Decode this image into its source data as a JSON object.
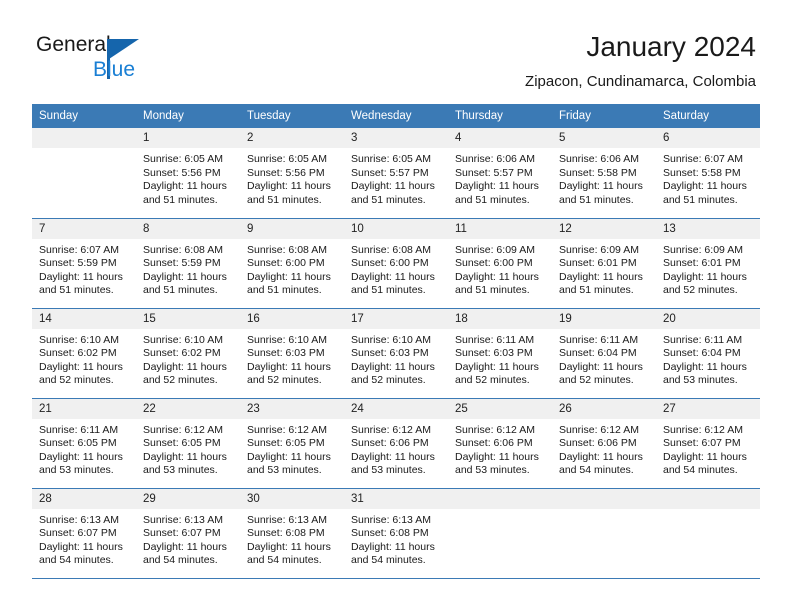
{
  "brand": {
    "line1": "General",
    "line2": "Blue",
    "mark_icon": "triangle-logo-icon"
  },
  "header": {
    "title": "January 2024",
    "subtitle": "Zipacon, Cundinamarca, Colombia"
  },
  "colors": {
    "header_blue": "#3b7ab5",
    "brand_blue": "#1a7fd4",
    "mark_blue": "#1565ac",
    "daynum_bg": "#f0f0f0"
  },
  "weekdays": [
    "Sunday",
    "Monday",
    "Tuesday",
    "Wednesday",
    "Thursday",
    "Friday",
    "Saturday"
  ],
  "labels": {
    "sunrise_prefix": "Sunrise:",
    "sunset_prefix": "Sunset:",
    "daylight_prefix": "Daylight:"
  },
  "weeks": [
    [
      {
        "empty": true
      },
      {
        "day": "1",
        "sunrise": "Sunrise: 6:05 AM",
        "sunset": "Sunset: 5:56 PM",
        "daylight1": "Daylight: 11 hours",
        "daylight2": "and 51 minutes."
      },
      {
        "day": "2",
        "sunrise": "Sunrise: 6:05 AM",
        "sunset": "Sunset: 5:56 PM",
        "daylight1": "Daylight: 11 hours",
        "daylight2": "and 51 minutes."
      },
      {
        "day": "3",
        "sunrise": "Sunrise: 6:05 AM",
        "sunset": "Sunset: 5:57 PM",
        "daylight1": "Daylight: 11 hours",
        "daylight2": "and 51 minutes."
      },
      {
        "day": "4",
        "sunrise": "Sunrise: 6:06 AM",
        "sunset": "Sunset: 5:57 PM",
        "daylight1": "Daylight: 11 hours",
        "daylight2": "and 51 minutes."
      },
      {
        "day": "5",
        "sunrise": "Sunrise: 6:06 AM",
        "sunset": "Sunset: 5:58 PM",
        "daylight1": "Daylight: 11 hours",
        "daylight2": "and 51 minutes."
      },
      {
        "day": "6",
        "sunrise": "Sunrise: 6:07 AM",
        "sunset": "Sunset: 5:58 PM",
        "daylight1": "Daylight: 11 hours",
        "daylight2": "and 51 minutes."
      }
    ],
    [
      {
        "day": "7",
        "sunrise": "Sunrise: 6:07 AM",
        "sunset": "Sunset: 5:59 PM",
        "daylight1": "Daylight: 11 hours",
        "daylight2": "and 51 minutes."
      },
      {
        "day": "8",
        "sunrise": "Sunrise: 6:08 AM",
        "sunset": "Sunset: 5:59 PM",
        "daylight1": "Daylight: 11 hours",
        "daylight2": "and 51 minutes."
      },
      {
        "day": "9",
        "sunrise": "Sunrise: 6:08 AM",
        "sunset": "Sunset: 6:00 PM",
        "daylight1": "Daylight: 11 hours",
        "daylight2": "and 51 minutes."
      },
      {
        "day": "10",
        "sunrise": "Sunrise: 6:08 AM",
        "sunset": "Sunset: 6:00 PM",
        "daylight1": "Daylight: 11 hours",
        "daylight2": "and 51 minutes."
      },
      {
        "day": "11",
        "sunrise": "Sunrise: 6:09 AM",
        "sunset": "Sunset: 6:00 PM",
        "daylight1": "Daylight: 11 hours",
        "daylight2": "and 51 minutes."
      },
      {
        "day": "12",
        "sunrise": "Sunrise: 6:09 AM",
        "sunset": "Sunset: 6:01 PM",
        "daylight1": "Daylight: 11 hours",
        "daylight2": "and 51 minutes."
      },
      {
        "day": "13",
        "sunrise": "Sunrise: 6:09 AM",
        "sunset": "Sunset: 6:01 PM",
        "daylight1": "Daylight: 11 hours",
        "daylight2": "and 52 minutes."
      }
    ],
    [
      {
        "day": "14",
        "sunrise": "Sunrise: 6:10 AM",
        "sunset": "Sunset: 6:02 PM",
        "daylight1": "Daylight: 11 hours",
        "daylight2": "and 52 minutes."
      },
      {
        "day": "15",
        "sunrise": "Sunrise: 6:10 AM",
        "sunset": "Sunset: 6:02 PM",
        "daylight1": "Daylight: 11 hours",
        "daylight2": "and 52 minutes."
      },
      {
        "day": "16",
        "sunrise": "Sunrise: 6:10 AM",
        "sunset": "Sunset: 6:03 PM",
        "daylight1": "Daylight: 11 hours",
        "daylight2": "and 52 minutes."
      },
      {
        "day": "17",
        "sunrise": "Sunrise: 6:10 AM",
        "sunset": "Sunset: 6:03 PM",
        "daylight1": "Daylight: 11 hours",
        "daylight2": "and 52 minutes."
      },
      {
        "day": "18",
        "sunrise": "Sunrise: 6:11 AM",
        "sunset": "Sunset: 6:03 PM",
        "daylight1": "Daylight: 11 hours",
        "daylight2": "and 52 minutes."
      },
      {
        "day": "19",
        "sunrise": "Sunrise: 6:11 AM",
        "sunset": "Sunset: 6:04 PM",
        "daylight1": "Daylight: 11 hours",
        "daylight2": "and 52 minutes."
      },
      {
        "day": "20",
        "sunrise": "Sunrise: 6:11 AM",
        "sunset": "Sunset: 6:04 PM",
        "daylight1": "Daylight: 11 hours",
        "daylight2": "and 53 minutes."
      }
    ],
    [
      {
        "day": "21",
        "sunrise": "Sunrise: 6:11 AM",
        "sunset": "Sunset: 6:05 PM",
        "daylight1": "Daylight: 11 hours",
        "daylight2": "and 53 minutes."
      },
      {
        "day": "22",
        "sunrise": "Sunrise: 6:12 AM",
        "sunset": "Sunset: 6:05 PM",
        "daylight1": "Daylight: 11 hours",
        "daylight2": "and 53 minutes."
      },
      {
        "day": "23",
        "sunrise": "Sunrise: 6:12 AM",
        "sunset": "Sunset: 6:05 PM",
        "daylight1": "Daylight: 11 hours",
        "daylight2": "and 53 minutes."
      },
      {
        "day": "24",
        "sunrise": "Sunrise: 6:12 AM",
        "sunset": "Sunset: 6:06 PM",
        "daylight1": "Daylight: 11 hours",
        "daylight2": "and 53 minutes."
      },
      {
        "day": "25",
        "sunrise": "Sunrise: 6:12 AM",
        "sunset": "Sunset: 6:06 PM",
        "daylight1": "Daylight: 11 hours",
        "daylight2": "and 53 minutes."
      },
      {
        "day": "26",
        "sunrise": "Sunrise: 6:12 AM",
        "sunset": "Sunset: 6:06 PM",
        "daylight1": "Daylight: 11 hours",
        "daylight2": "and 54 minutes."
      },
      {
        "day": "27",
        "sunrise": "Sunrise: 6:12 AM",
        "sunset": "Sunset: 6:07 PM",
        "daylight1": "Daylight: 11 hours",
        "daylight2": "and 54 minutes."
      }
    ],
    [
      {
        "day": "28",
        "sunrise": "Sunrise: 6:13 AM",
        "sunset": "Sunset: 6:07 PM",
        "daylight1": "Daylight: 11 hours",
        "daylight2": "and 54 minutes."
      },
      {
        "day": "29",
        "sunrise": "Sunrise: 6:13 AM",
        "sunset": "Sunset: 6:07 PM",
        "daylight1": "Daylight: 11 hours",
        "daylight2": "and 54 minutes."
      },
      {
        "day": "30",
        "sunrise": "Sunrise: 6:13 AM",
        "sunset": "Sunset: 6:08 PM",
        "daylight1": "Daylight: 11 hours",
        "daylight2": "and 54 minutes."
      },
      {
        "day": "31",
        "sunrise": "Sunrise: 6:13 AM",
        "sunset": "Sunset: 6:08 PM",
        "daylight1": "Daylight: 11 hours",
        "daylight2": "and 54 minutes."
      },
      {
        "empty": true
      },
      {
        "empty": true
      },
      {
        "empty": true
      }
    ]
  ]
}
